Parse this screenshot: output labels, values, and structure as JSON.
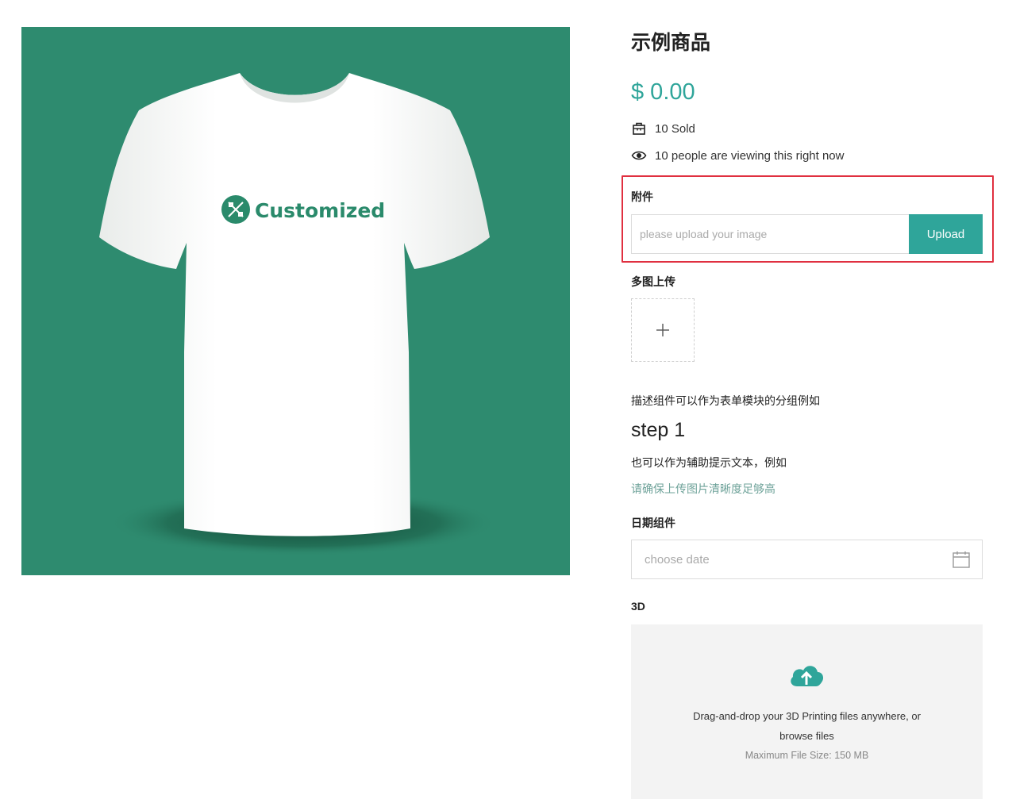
{
  "product": {
    "title": "示例商品",
    "price": "$ 0.00",
    "sold": "10 Sold",
    "viewing": "10 people are viewing this right now",
    "image_logo_text": "Customized",
    "image_bg_color": "#2e8b6f"
  },
  "attachment": {
    "label": "附件",
    "placeholder": "please upload your image",
    "button_label": "Upload"
  },
  "multi_upload": {
    "label": "多图上传",
    "add_icon": "plus-icon"
  },
  "description": {
    "text": "描述组件可以作为表单模块的分组例如",
    "step_heading": "step 1",
    "aux_text": "也可以作为辅助提示文本，例如",
    "hint_text": "请确保上传图片清晰度足够高"
  },
  "date_field": {
    "label": "日期组件",
    "placeholder": "choose date",
    "icon": "calendar-icon"
  },
  "upload_3d": {
    "label": "3D",
    "drop_text": "Drag-and-drop your 3D Printing files anywhere, or",
    "browse_text": "browse files",
    "max_size": "Maximum File Size: 150 MB",
    "icon": "cloud-upload-icon"
  },
  "colors": {
    "accent": "#2fa59a",
    "highlight_border": "#e03040",
    "hint": "#6fa39a"
  }
}
